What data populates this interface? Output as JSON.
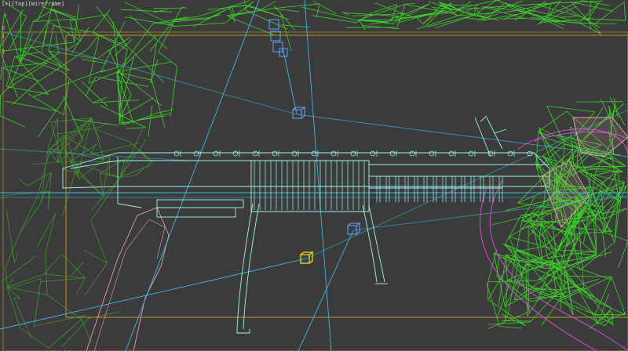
{
  "viewport": {
    "label": "[+][Top][Wireframe]",
    "gutter_marks": [
      "6",
      "1",
      "2",
      "5"
    ]
  },
  "colors": {
    "background": "#3b3b3b",
    "terrain": "#3ecf2a",
    "structure": "#9ff5e8",
    "guides": "#3fb7e6",
    "frame": "#c8902a",
    "magenta": "#d04ed0",
    "pink": "#e4a0b0",
    "selected": "#f0e020"
  },
  "icons": [
    "camera-target-icon",
    "light-helper-icon",
    "selected-helper-icon"
  ]
}
